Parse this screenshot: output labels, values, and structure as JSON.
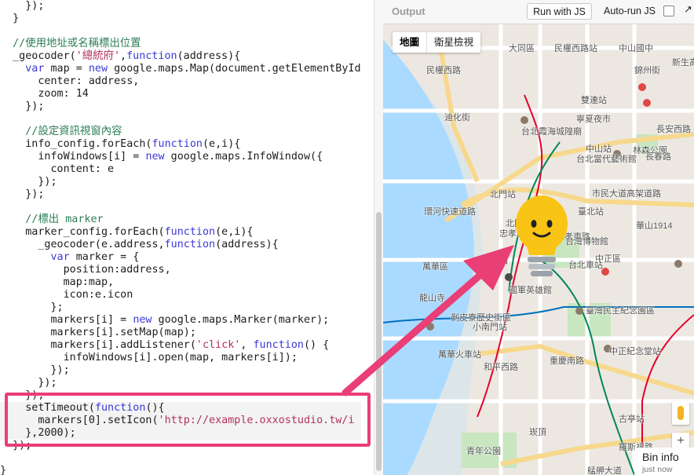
{
  "editor": {
    "lines": [
      "    });",
      "  }",
      "",
      "  //使用地址或名稱標出位置",
      "  _geocoder('總統府',function(address){",
      "    var map = new google.maps.Map(document.getElementById",
      "      center: address,",
      "      zoom: 14",
      "    });",
      "",
      "    //設定資訊視窗內容",
      "    info_config.forEach(function(e,i){",
      "      infoWindows[i] = new google.maps.InfoWindow({",
      "        content: e",
      "      });",
      "    });",
      "",
      "    //標出 marker",
      "    marker_config.forEach(function(e,i){",
      "      _geocoder(e.address,function(address){",
      "        var marker = {",
      "          position:address,",
      "          map:map,",
      "          icon:e.icon",
      "        };",
      "        markers[i] = new google.maps.Marker(marker);",
      "        markers[i].setMap(map);",
      "        markers[i].addListener('click', function() {",
      "          infoWindows[i].open(map, markers[i]);",
      "        });",
      "      });",
      "    });",
      "    setTimeout(function(){",
      "      markers[0].setIcon('http://example.oxxostudio.tw/i",
      "    },2000);",
      "  });",
      "",
      "}"
    ]
  },
  "output": {
    "title": "Output",
    "run_label": "Run with JS",
    "autorun_label": "Auto-run JS",
    "autorun_checked": false,
    "expand_icon": "expand-arrow-icon"
  },
  "map": {
    "type_controls": [
      "地圖",
      "衛星檢視"
    ],
    "selected_type": "地圖",
    "labels": [
      "大同區",
      "民權西路站",
      "中山國中",
      "新生高架道路",
      "民權西路",
      "錦州街",
      "雙連站",
      "寧夏夜市",
      "台北霞海城隍廟",
      "迪化街",
      "長安西路",
      "中山站",
      "林森公園",
      "台北當代藝術館",
      "長春路",
      "北門站",
      "市民大道高架道路",
      "華山1914",
      "臺北站",
      "環河快速道路",
      "北門",
      "忠孝東路",
      "萬華區",
      "中正區",
      "西門站",
      "台灣博物館",
      "台北車站",
      "忠孝西路",
      "龍山寺",
      "國軍英雄館",
      "剝皮寮歷史街區",
      "小南門站",
      "臺灣民主紀念園區",
      "中正紀念堂站",
      "和平西路",
      "萬華火車站",
      "古亭站",
      "青年公園",
      "崁頂",
      "艋舺大道",
      "重慶南路",
      "羅斯福路"
    ]
  },
  "bin_info": {
    "title": "Bin info",
    "subtitle": "just now"
  },
  "colors": {
    "callout": "#ea3e77",
    "bulb": "#f9c415",
    "keyword": "#3d38d6",
    "string": "#b0325e",
    "comment": "#2c7f57"
  }
}
